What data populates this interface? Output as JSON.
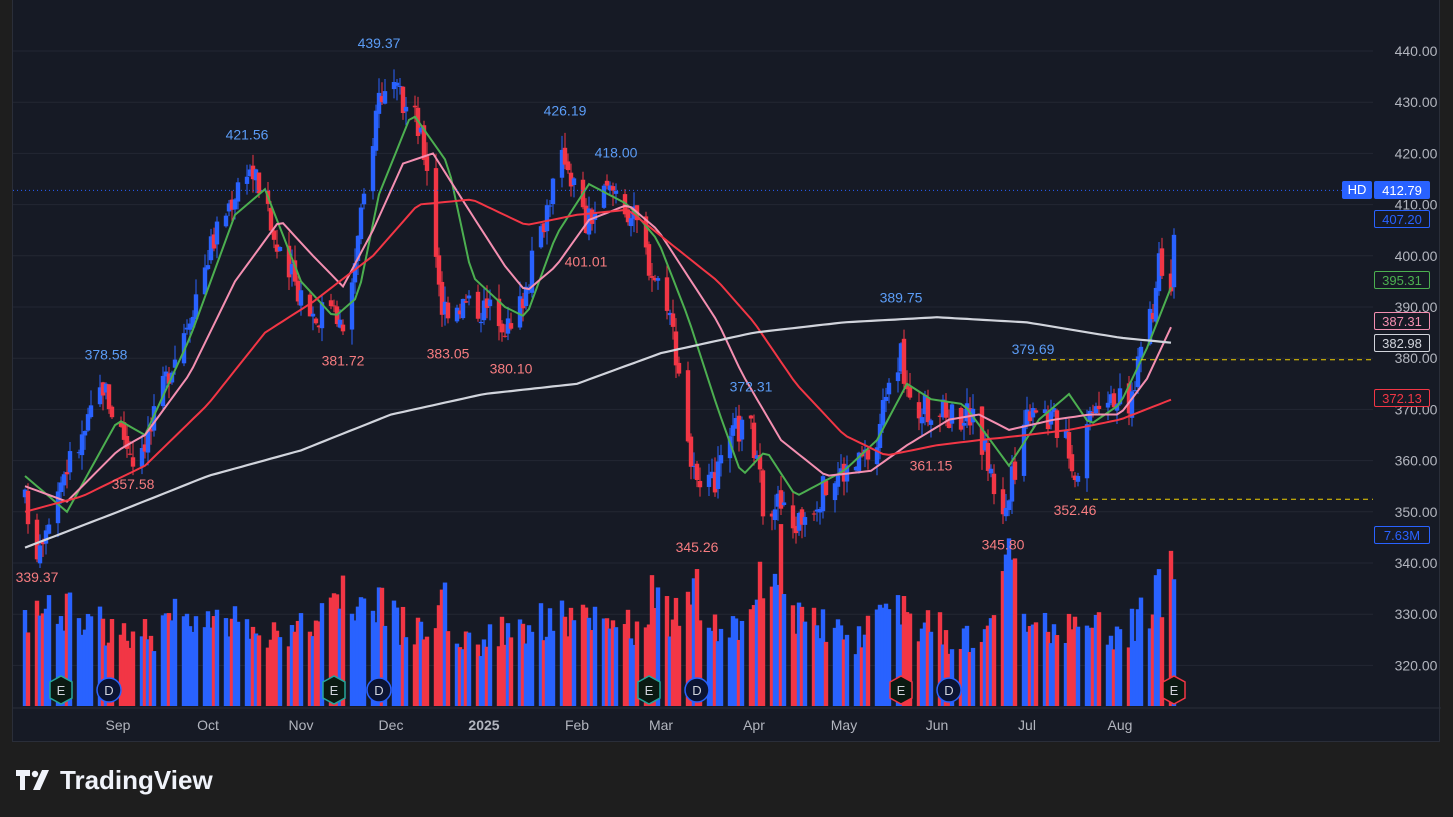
{
  "brand": {
    "name": "TradingView"
  },
  "colors": {
    "background": "#161a25",
    "up": "#2962ff",
    "down": "#f23645",
    "sma_fast": "#4caf50",
    "sma_mid": "#f48fb1",
    "sma_slow": "#f23645",
    "sma_long": "#d1d4dc",
    "annotation_high": "#5b9cf6",
    "annotation_low": "#f77c80"
  },
  "chart_data": {
    "type": "candlestick",
    "symbol_badge": "HD",
    "x_ticks": [
      "Sep",
      "Oct",
      "Nov",
      "Dec",
      "2025",
      "Feb",
      "Mar",
      "Apr",
      "May",
      "Jun",
      "Jul",
      "Aug"
    ],
    "y_ticks": [
      "440.00",
      "430.00",
      "420.00",
      "410.00",
      "400.00",
      "390.00",
      "380.00",
      "370.00",
      "360.00",
      "350.00",
      "340.00",
      "330.00",
      "320.00"
    ],
    "ylim": [
      314,
      450
    ],
    "last_price": "412.79",
    "price_labels": [
      {
        "value": "412.79",
        "kind": "last"
      },
      {
        "value": "407.20",
        "kind": "outline_blue"
      },
      {
        "value": "395.31",
        "kind": "sma_fast"
      },
      {
        "value": "387.31",
        "kind": "sma_mid"
      },
      {
        "value": "382.98",
        "kind": "sma_long"
      },
      {
        "value": "372.13",
        "kind": "sma_slow"
      },
      {
        "value": "7.63M",
        "kind": "volume"
      }
    ],
    "high_low_annotations": [
      {
        "text": "378.58",
        "type": "high",
        "date": "2024-08-28",
        "value": 378.58
      },
      {
        "text": "357.58",
        "type": "low",
        "date": "2024-09-06",
        "value": 357.58
      },
      {
        "text": "339.37",
        "type": "low",
        "date": "2024-08-05",
        "value": 339.37
      },
      {
        "text": "421.56",
        "type": "high",
        "date": "2024-10-14",
        "value": 421.56
      },
      {
        "text": "381.72",
        "type": "low",
        "date": "2024-11-15",
        "value": 381.72
      },
      {
        "text": "439.37",
        "type": "high",
        "date": "2024-11-27",
        "value": 439.37
      },
      {
        "text": "383.05",
        "type": "low",
        "date": "2024-12-20",
        "value": 383.05
      },
      {
        "text": "380.10",
        "type": "low",
        "date": "2025-01-10",
        "value": 380.1
      },
      {
        "text": "426.19",
        "type": "high",
        "date": "2025-01-28",
        "value": 426.19
      },
      {
        "text": "401.01",
        "type": "low",
        "date": "2025-02-04",
        "value": 401.01
      },
      {
        "text": "418.00",
        "type": "high",
        "date": "2025-02-14",
        "value": 418.0
      },
      {
        "text": "345.26",
        "type": "low",
        "date": "2025-03-13",
        "value": 345.26
      },
      {
        "text": "372.31",
        "type": "high",
        "date": "2025-03-31",
        "value": 372.31
      },
      {
        "text": "389.75",
        "type": "high",
        "date": "2025-05-20",
        "value": 389.75
      },
      {
        "text": "361.15",
        "type": "low",
        "date": "2025-05-30",
        "value": 361.15
      },
      {
        "text": "345.80",
        "type": "low",
        "date": "2025-06-23",
        "value": 345.8
      },
      {
        "text": "379.69",
        "type": "high",
        "date": "2025-07-03",
        "value": 379.69
      },
      {
        "text": "352.46",
        "type": "low",
        "date": "2025-07-17",
        "value": 352.46
      }
    ],
    "dashed_levels": [
      {
        "value": 379.69,
        "from": "2025-07-03"
      },
      {
        "value": 352.46,
        "from": "2025-07-17"
      }
    ],
    "event_markers": [
      {
        "label": "E",
        "type": "earnings",
        "date": "2024-08-13",
        "color": "up"
      },
      {
        "label": "D",
        "type": "dividend",
        "date": "2024-08-29",
        "color": "up"
      },
      {
        "label": "E",
        "type": "earnings",
        "date": "2024-11-12",
        "color": "up"
      },
      {
        "label": "D",
        "type": "dividend",
        "date": "2024-11-27",
        "color": "up"
      },
      {
        "label": "E",
        "type": "earnings",
        "date": "2025-02-25",
        "color": "up"
      },
      {
        "label": "D",
        "type": "dividend",
        "date": "2025-03-13",
        "color": "up"
      },
      {
        "label": "E",
        "type": "earnings",
        "date": "2025-05-20",
        "color": "down"
      },
      {
        "label": "D",
        "type": "dividend",
        "date": "2025-06-05",
        "color": "up"
      },
      {
        "label": "E",
        "type": "earnings",
        "date": "2025-08-19",
        "color": "down"
      }
    ],
    "moving_averages": [
      {
        "key": "sma_fast",
        "last": 395.31,
        "anchors": [
          [
            "2024-08-01",
            357
          ],
          [
            "2024-08-15",
            350
          ],
          [
            "2024-09-01",
            368
          ],
          [
            "2024-09-10",
            365
          ],
          [
            "2024-09-25",
            384
          ],
          [
            "2024-10-10",
            408
          ],
          [
            "2024-10-20",
            413
          ],
          [
            "2024-11-01",
            395
          ],
          [
            "2024-11-12",
            388
          ],
          [
            "2024-11-20",
            392
          ],
          [
            "2024-11-27",
            412
          ],
          [
            "2024-12-08",
            428
          ],
          [
            "2024-12-20",
            418
          ],
          [
            "2024-12-28",
            396
          ],
          [
            "2025-01-08",
            390
          ],
          [
            "2025-01-15",
            388
          ],
          [
            "2025-01-25",
            404
          ],
          [
            "2025-02-05",
            414
          ],
          [
            "2025-02-18",
            410
          ],
          [
            "2025-02-28",
            403
          ],
          [
            "2025-03-10",
            388
          ],
          [
            "2025-03-20",
            370
          ],
          [
            "2025-03-28",
            357
          ],
          [
            "2025-04-05",
            362
          ],
          [
            "2025-04-15",
            353
          ],
          [
            "2025-05-01",
            358
          ],
          [
            "2025-05-12",
            364
          ],
          [
            "2025-05-22",
            375
          ],
          [
            "2025-05-30",
            372
          ],
          [
            "2025-06-10",
            371
          ],
          [
            "2025-06-25",
            359
          ],
          [
            "2025-07-05",
            368
          ],
          [
            "2025-07-15",
            373
          ],
          [
            "2025-07-22",
            367
          ],
          [
            "2025-08-01",
            371
          ],
          [
            "2025-08-10",
            382
          ],
          [
            "2025-08-19",
            395.31
          ]
        ]
      },
      {
        "key": "sma_mid",
        "last": 387.31,
        "anchors": [
          [
            "2024-08-01",
            355
          ],
          [
            "2024-08-15",
            352
          ],
          [
            "2024-09-01",
            362
          ],
          [
            "2024-09-10",
            365
          ],
          [
            "2024-09-25",
            377
          ],
          [
            "2024-10-10",
            395
          ],
          [
            "2024-10-25",
            407
          ],
          [
            "2024-11-05",
            400
          ],
          [
            "2024-11-15",
            394
          ],
          [
            "2024-11-25",
            405
          ],
          [
            "2024-12-05",
            418
          ],
          [
            "2024-12-15",
            420
          ],
          [
            "2024-12-28",
            408
          ],
          [
            "2025-01-08",
            398
          ],
          [
            "2025-01-15",
            393
          ],
          [
            "2025-01-25",
            398
          ],
          [
            "2025-02-05",
            407
          ],
          [
            "2025-02-18",
            410
          ],
          [
            "2025-02-28",
            405
          ],
          [
            "2025-03-10",
            396
          ],
          [
            "2025-03-20",
            387
          ],
          [
            "2025-03-28",
            377
          ],
          [
            "2025-04-10",
            364
          ],
          [
            "2025-04-25",
            357
          ],
          [
            "2025-05-10",
            358
          ],
          [
            "2025-05-22",
            363
          ],
          [
            "2025-06-05",
            368
          ],
          [
            "2025-06-15",
            369
          ],
          [
            "2025-06-25",
            366
          ],
          [
            "2025-07-10",
            368
          ],
          [
            "2025-07-22",
            369
          ],
          [
            "2025-08-01",
            369
          ],
          [
            "2025-08-10",
            376
          ],
          [
            "2025-08-19",
            387.31
          ]
        ]
      },
      {
        "key": "sma_slow",
        "last": 372.13,
        "anchors": [
          [
            "2024-08-01",
            350
          ],
          [
            "2024-08-20",
            353
          ],
          [
            "2024-09-10",
            359
          ],
          [
            "2024-10-01",
            371
          ],
          [
            "2024-10-20",
            385
          ],
          [
            "2024-11-05",
            391
          ],
          [
            "2024-11-25",
            400
          ],
          [
            "2024-12-10",
            410
          ],
          [
            "2024-12-28",
            411
          ],
          [
            "2025-01-15",
            406
          ],
          [
            "2025-02-01",
            408
          ],
          [
            "2025-02-18",
            409
          ],
          [
            "2025-03-05",
            402
          ],
          [
            "2025-03-20",
            395
          ],
          [
            "2025-04-01",
            387
          ],
          [
            "2025-04-15",
            375
          ],
          [
            "2025-05-01",
            365
          ],
          [
            "2025-05-15",
            361
          ],
          [
            "2025-06-01",
            363
          ],
          [
            "2025-06-15",
            364
          ],
          [
            "2025-07-01",
            365
          ],
          [
            "2025-07-15",
            366
          ],
          [
            "2025-08-01",
            368
          ],
          [
            "2025-08-19",
            372.13
          ]
        ]
      },
      {
        "key": "sma_long",
        "last": 382.98,
        "anchors": [
          [
            "2024-08-01",
            343
          ],
          [
            "2024-09-01",
            350
          ],
          [
            "2024-10-01",
            357
          ],
          [
            "2024-11-01",
            362
          ],
          [
            "2024-12-01",
            369
          ],
          [
            "2025-01-01",
            373
          ],
          [
            "2025-02-01",
            375
          ],
          [
            "2025-03-01",
            381
          ],
          [
            "2025-04-01",
            385
          ],
          [
            "2025-05-01",
            387
          ],
          [
            "2025-06-01",
            388
          ],
          [
            "2025-07-01",
            387
          ],
          [
            "2025-08-01",
            384
          ],
          [
            "2025-08-19",
            382.98
          ]
        ]
      }
    ],
    "price_path": [
      [
        "2024-08-01",
        352,
        0.9
      ],
      [
        "2024-08-05",
        343,
        1.2
      ],
      [
        "2024-08-09",
        350,
        1.0
      ],
      [
        "2024-08-14",
        358,
        1.1
      ],
      [
        "2024-08-20",
        364,
        0.9
      ],
      [
        "2024-08-27",
        375,
        1.0
      ],
      [
        "2024-08-30",
        370,
        0.8
      ],
      [
        "2024-09-06",
        361,
        0.9
      ],
      [
        "2024-09-12",
        366,
        0.8
      ],
      [
        "2024-09-18",
        378,
        1.0
      ],
      [
        "2024-09-25",
        389,
        0.9
      ],
      [
        "2024-10-02",
        402,
        1.0
      ],
      [
        "2024-10-08",
        410,
        0.9
      ],
      [
        "2024-10-14",
        418,
        1.0
      ],
      [
        "2024-10-18",
        414,
        0.9
      ],
      [
        "2024-10-25",
        399,
        0.9
      ],
      [
        "2024-10-31",
        394,
        0.8
      ],
      [
        "2024-11-06",
        388,
        1.1
      ],
      [
        "2024-11-12",
        392,
        1.1
      ],
      [
        "2024-11-15",
        384,
        1.2
      ],
      [
        "2024-11-20",
        403,
        1.0
      ],
      [
        "2024-11-27",
        432,
        1.3
      ],
      [
        "2024-12-03",
        431,
        0.9
      ],
      [
        "2024-12-09",
        427,
        0.9
      ],
      [
        "2024-12-13",
        418,
        0.9
      ],
      [
        "2024-12-18",
        390,
        1.2
      ],
      [
        "2024-12-23",
        391,
        0.9
      ],
      [
        "2024-12-31",
        390,
        0.7
      ],
      [
        "2025-01-06",
        389,
        0.8
      ],
      [
        "2025-01-10",
        385,
        1.0
      ],
      [
        "2025-01-16",
        396,
        0.9
      ],
      [
        "2025-01-23",
        412,
        1.0
      ],
      [
        "2025-01-28",
        420,
        1.0
      ],
      [
        "2025-02-04",
        406,
        1.0
      ],
      [
        "2025-02-10",
        412,
        0.8
      ],
      [
        "2025-02-14",
        413,
        0.9
      ],
      [
        "2025-02-21",
        406,
        0.9
      ],
      [
        "2025-02-26",
        397,
        1.2
      ],
      [
        "2025-03-03",
        392,
        1.0
      ],
      [
        "2025-03-07",
        378,
        1.1
      ],
      [
        "2025-03-11",
        360,
        1.2
      ],
      [
        "2025-03-14",
        352,
        1.3
      ],
      [
        "2025-03-20",
        357,
        0.9
      ],
      [
        "2025-03-26",
        366,
        0.8
      ],
      [
        "2025-03-31",
        366,
        1.0
      ],
      [
        "2025-04-04",
        352,
        1.6
      ],
      [
        "2025-04-09",
        352,
        1.8
      ],
      [
        "2025-04-14",
        347,
        1.1
      ],
      [
        "2025-04-21",
        352,
        0.9
      ],
      [
        "2025-04-28",
        357,
        0.9
      ],
      [
        "2025-05-05",
        359,
        0.8
      ],
      [
        "2025-05-12",
        363,
        0.9
      ],
      [
        "2025-05-16",
        378,
        1.0
      ],
      [
        "2025-05-20",
        380,
        1.2
      ],
      [
        "2025-05-23",
        370,
        1.0
      ],
      [
        "2025-05-30",
        370,
        0.9
      ],
      [
        "2025-06-05",
        369,
        0.8
      ],
      [
        "2025-06-12",
        369,
        0.8
      ],
      [
        "2025-06-17",
        362,
        0.9
      ],
      [
        "2025-06-20",
        355,
        1.1
      ],
      [
        "2025-06-24",
        350,
        1.6
      ],
      [
        "2025-06-30",
        368,
        1.2
      ],
      [
        "2025-07-03",
        372,
        1.0
      ],
      [
        "2025-07-09",
        368,
        0.9
      ],
      [
        "2025-07-14",
        366,
        0.9
      ],
      [
        "2025-07-17",
        357,
        1.0
      ],
      [
        "2025-07-23",
        372,
        0.9
      ],
      [
        "2025-07-29",
        374,
        0.8
      ],
      [
        "2025-08-04",
        369,
        0.9
      ],
      [
        "2025-08-08",
        383,
        1.0
      ],
      [
        "2025-08-12",
        388,
        1.1
      ],
      [
        "2025-08-14",
        400,
        1.3
      ],
      [
        "2025-08-18",
        396,
        1.4
      ],
      [
        "2025-08-19",
        407,
        1.6
      ]
    ]
  }
}
